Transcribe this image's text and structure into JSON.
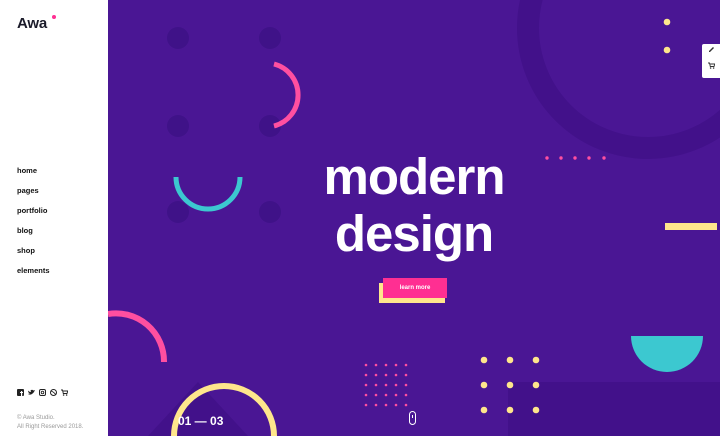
{
  "brand": {
    "logo_text": "Awa"
  },
  "nav": {
    "items": [
      "home",
      "pages",
      "portfolio",
      "blog",
      "shop",
      "elements"
    ]
  },
  "social_icons": [
    "facebook-icon",
    "twitter-icon",
    "instagram-icon",
    "dribbble-icon",
    "cart-icon"
  ],
  "footer": {
    "line1": "© Awa Studio.",
    "line2": "All Right Reserved 2018."
  },
  "hero": {
    "line1": "modern",
    "line2": "design",
    "cta": "learn more",
    "counter": "01 — 03"
  },
  "side_tools": [
    "edit-icon",
    "cart-icon"
  ],
  "colors": {
    "hero_bg": "#4a1694",
    "accent_pink": "#ff2f92",
    "accent_teal": "#3cc8d0",
    "accent_yellow": "#ffe68c"
  }
}
